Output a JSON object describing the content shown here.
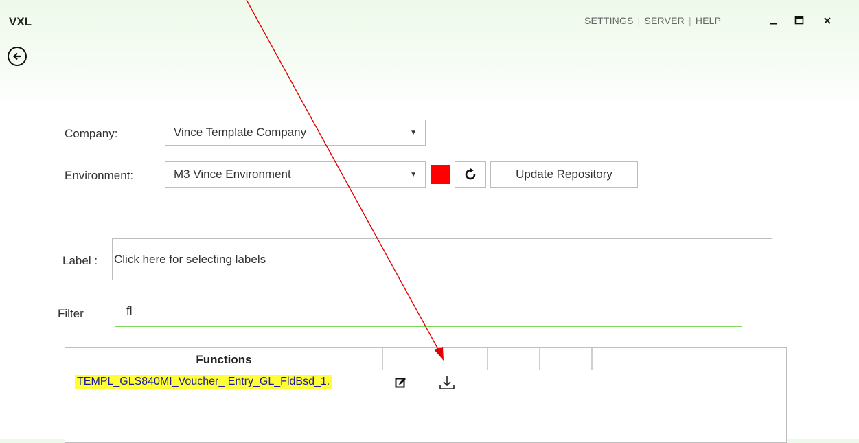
{
  "app": {
    "title": "VXL"
  },
  "topnav": {
    "settings": "SETTINGS",
    "server": "SERVER",
    "help": "HELP",
    "separator": "|"
  },
  "window_controls": {
    "minimize_icon": "minimize-icon",
    "maximize_icon": "maximize-icon",
    "close_icon": "close-icon"
  },
  "back": {
    "icon": "back-arrow-icon"
  },
  "company": {
    "label": "Company:",
    "value": "Vince Template Company"
  },
  "environment": {
    "label": "Environment:",
    "value": "M3 Vince Environment",
    "status_color": "#ff0000"
  },
  "refresh": {
    "icon": "refresh-icon"
  },
  "update_repository": {
    "label": "Update Repository"
  },
  "label_field": {
    "label": "Label :",
    "placeholder": "Click here for selecting labels"
  },
  "filter": {
    "label": "Filter",
    "value": "fl",
    "border_color": "#7cd65a"
  },
  "grid": {
    "header": "Functions",
    "rows": [
      {
        "name": "TEMPL_GLS840MI_Voucher_ Entry_GL_FldBsd_1.",
        "highlight": "#ffff33",
        "actions": [
          "edit-icon",
          "download-icon"
        ]
      }
    ]
  },
  "annotation": {
    "color": "#e00000"
  }
}
